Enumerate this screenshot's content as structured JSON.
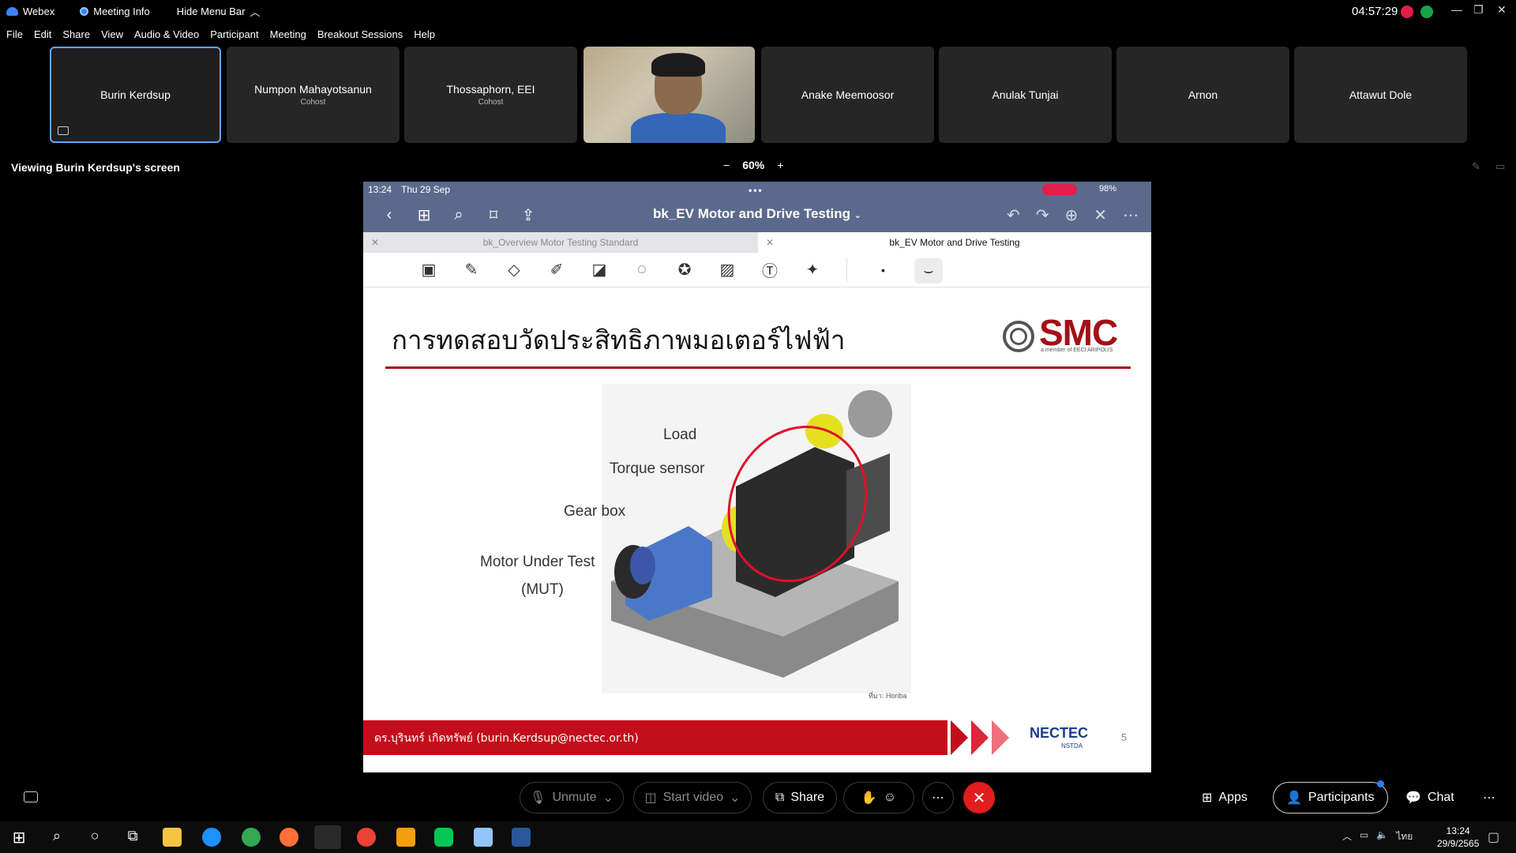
{
  "titlebar": {
    "app_name": "Webex",
    "meeting_info": "Meeting Info",
    "hide_menu": "Hide Menu Bar",
    "time": "04:57:29"
  },
  "menu": [
    "File",
    "Edit",
    "Share",
    "View",
    "Audio & Video",
    "Participant",
    "Meeting",
    "Breakout Sessions",
    "Help"
  ],
  "participants": [
    {
      "name": "Burin Kerdsup",
      "role": ""
    },
    {
      "name": "Numpon Mahayotsanun",
      "role": "Cohost"
    },
    {
      "name": "Thossaphorn, EEI",
      "role": "Cohost"
    },
    {
      "name": "",
      "role": ""
    },
    {
      "name": "Anake Meemoosor",
      "role": ""
    },
    {
      "name": "Anulak Tunjai",
      "role": ""
    },
    {
      "name": "Arnon",
      "role": ""
    },
    {
      "name": "Attawut Dole",
      "role": ""
    }
  ],
  "viewing": "Viewing Burin Kerdsup's screen",
  "zoom": {
    "minus": "−",
    "level": "60%",
    "plus": "+"
  },
  "ipad": {
    "time": "13:24",
    "date": "Thu 29 Sep",
    "battery": "98%",
    "doc_title": "bk_EV Motor and Drive Testing",
    "tabs": [
      "bk_Overview Motor Testing Standard",
      "bk_EV Motor and Drive Testing"
    ]
  },
  "slide": {
    "title": "การทดสอบวัดประสิทธิภาพมอเตอร์ไฟฟ้า",
    "logo_text": "SMC",
    "logo_sub": "a member of EECI ARIPOLIS",
    "labels": {
      "load": "Load",
      "torque": "Torque sensor",
      "gear": "Gear box",
      "mut1": "Motor Under Test",
      "mut2": "(MUT)"
    },
    "credit": "ที่มา: Horiba",
    "footer": "ดร.บุรินทร์  เกิดทรัพย์ (burin.Kerdsup@nectec.or.th)",
    "nectec": "NECTEC",
    "nstda": "NSTDA",
    "page": "5"
  },
  "controls": {
    "unmute": "Unmute",
    "start_video": "Start video",
    "share": "Share",
    "apps": "Apps",
    "participants": "Participants",
    "chat": "Chat"
  },
  "taskbar": {
    "lang": "ไทย",
    "time": "13:24",
    "date": "29/9/2565"
  },
  "colors": {
    "accent": "#60a5fa",
    "leave": "#e11d1d",
    "slide_red": "#c40d1a",
    "ipad_bar": "#5b6a8c"
  }
}
